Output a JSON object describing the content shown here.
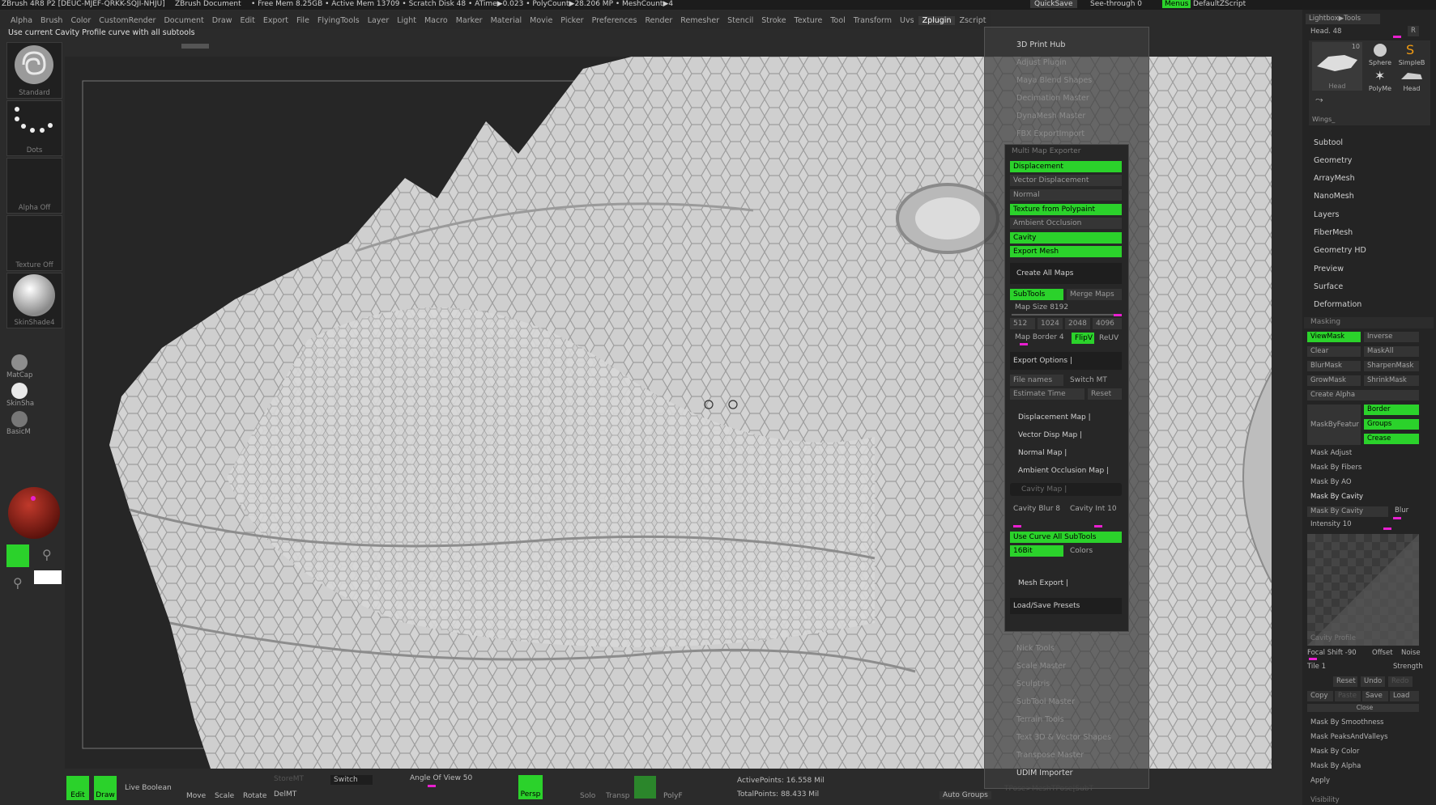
{
  "titlebar": {
    "app": "ZBrush 4R8 P2 [DEUC-MJEF-QRKK-SQJI-NHJU]",
    "doc": "ZBrush Document",
    "stats": "• Free Mem 8.25GB • Active Mem 13709 • Scratch Disk 48 • ATime▶0.023 • PolyCount▶28.206 MP • MeshCount▶4",
    "quicksave": "QuickSave",
    "see_through": "See-through  0",
    "menus": "Menus",
    "script": "DefaultZScript"
  },
  "menubar": {
    "items": [
      "Alpha",
      "Brush",
      "Color",
      "CustomRender",
      "Document",
      "Draw",
      "Edit",
      "Export",
      "File",
      "FlyingTools",
      "Layer",
      "Light",
      "Macro",
      "Marker",
      "Material",
      "Movie",
      "Picker",
      "Preferences",
      "Render",
      "Remesher",
      "Stencil",
      "Stroke",
      "Texture",
      "Tool",
      "Transform",
      "Uvs",
      "Zplugin",
      "Zscript"
    ],
    "active": "Zplugin"
  },
  "status_text": "Use current Cavity Profile curve with all subtools",
  "left_shelf": {
    "brush": "Standard",
    "stroke": "Dots",
    "alpha": "Alpha Off",
    "texture": "Texture Off",
    "material": "SkinShade4",
    "matcap": "MatCap",
    "skinsha": "SkinSha",
    "basicm": "BasicM"
  },
  "bottombar": {
    "edit": "Edit",
    "draw": "Draw",
    "live_boolean": "Live Boolean",
    "move": "Move",
    "scale": "Scale",
    "rotate": "Rotate",
    "storemt": "StoreMT",
    "delmt": "DelMT",
    "switch": "Switch",
    "angle_of_view": "Angle Of View 50",
    "persp": "Persp",
    "solo": "Solo",
    "transp": "Transp",
    "polyf": "PolyF",
    "active_points": "ActivePoints: 16.558 Mil",
    "total_points": "TotalPoints: 88.433 Mil",
    "auto_groups": "Auto Groups",
    "tpose_mesh": "TPose>Mesh",
    "tpose_subt": "TPose|SubT"
  },
  "zplugin": {
    "items_top": [
      "3D Print Hub",
      "Adjust Plugin",
      "Maya Blend Shapes",
      "Decimation Master",
      "DynaMesh Master",
      "FBX ExportImport",
      "Multi Map Exporter"
    ],
    "items_bottom": [
      "Nick Tools",
      "Scale Master",
      "Sculptris",
      "SubTool Master",
      "Terrain Tools",
      "Text 3D & Vector Shapes",
      "Transpose Master",
      "UDIM Importer"
    ]
  },
  "multimap": {
    "title": "Multi Map Exporter",
    "displacement": "Displacement",
    "vector_displacement": "Vector Displacement",
    "normal": "Normal",
    "texture_from_polypaint": "Texture from Polypaint",
    "ambient_occlusion": "Ambient Occlusion",
    "cavity": "Cavity",
    "export_mesh": "Export Mesh",
    "create_all_maps": "Create All Maps",
    "subtools": "SubTools",
    "merge_maps": "Merge Maps",
    "map_size": "Map Size 8192",
    "sizes": [
      "512",
      "1024",
      "2048",
      "4096"
    ],
    "map_border": "Map Border 4",
    "flipv": "FlipV",
    "reuv": "ReUV",
    "export_options": "Export Options  |",
    "file_names": "File names",
    "switch_mt": "Switch MT",
    "estimate_time": "Estimate Time",
    "reset": "Reset",
    "displacement_map": "Displacement Map  |",
    "vector_disp_map": "Vector Disp Map  |",
    "normal_map": "Normal Map  |",
    "ambient_occlusion_map": "Ambient Occlusion Map  |",
    "cavity_map": "Cavity Map  |",
    "cavity_blur": "Cavity Blur 8",
    "cavity_int": "Cavity Int 10",
    "use_curve": "Use Curve All SubTools",
    "bit16": "16Bit",
    "colors": "Colors",
    "mesh_export": "Mesh Export  |",
    "load_save_presets": "Load/Save Presets"
  },
  "rightpanel": {
    "lightbox": "Lightbox▶Tools",
    "head": "Head. 48",
    "r": "R",
    "thumb_count": "10",
    "thumbs": [
      "Head",
      "Sphere",
      "SimpleB",
      "PolyMe",
      "Head"
    ],
    "wings": "Wings_",
    "menu": [
      "Subtool",
      "Geometry",
      "ArrayMesh",
      "NanoMesh",
      "Layers",
      "FiberMesh",
      "Geometry HD",
      "Preview",
      "Surface",
      "Deformation"
    ],
    "masking": "Masking",
    "viewmask": "ViewMask",
    "inverse": "Inverse",
    "clear": "Clear",
    "maskall": "MaskAll",
    "blurmask": "BlurMask",
    "sharpenmask": "SharpenMask",
    "growmask": "GrowMask",
    "shrinkmask": "ShrinkMask",
    "create_alpha": "Create Alpha",
    "maskbyfeature": "MaskByFeatur",
    "border": "Border",
    "groups": "Groups",
    "crease": "Crease",
    "mask_adjust": "Mask Adjust",
    "mask_by_fibers": "Mask By Fibers",
    "mask_by_ao": "Mask By AO",
    "mask_by_cavity_header": "Mask By Cavity",
    "mask_by_cavity": "Mask By Cavity",
    "blur": "Blur",
    "intensity": "Intensity 10",
    "cavity_profile": "Cavity Profile",
    "focal_shift": "Focal Shift -90",
    "offset": "Offset",
    "noise": "Noise",
    "tile": "Tile 1",
    "strength": "Strength",
    "reset": "Reset",
    "undo": "Undo",
    "redo": "Redo",
    "copy": "Copy",
    "paste": "Paste",
    "save": "Save",
    "load": "Load",
    "close": "Close",
    "mask_by_smoothness": "Mask By Smoothness",
    "mask_peaks": "Mask PeaksAndValleys",
    "mask_by_color": "Mask By Color",
    "mask_by_alpha": "Mask By Alpha",
    "apply": "Apply",
    "visibility": "Visibility"
  }
}
